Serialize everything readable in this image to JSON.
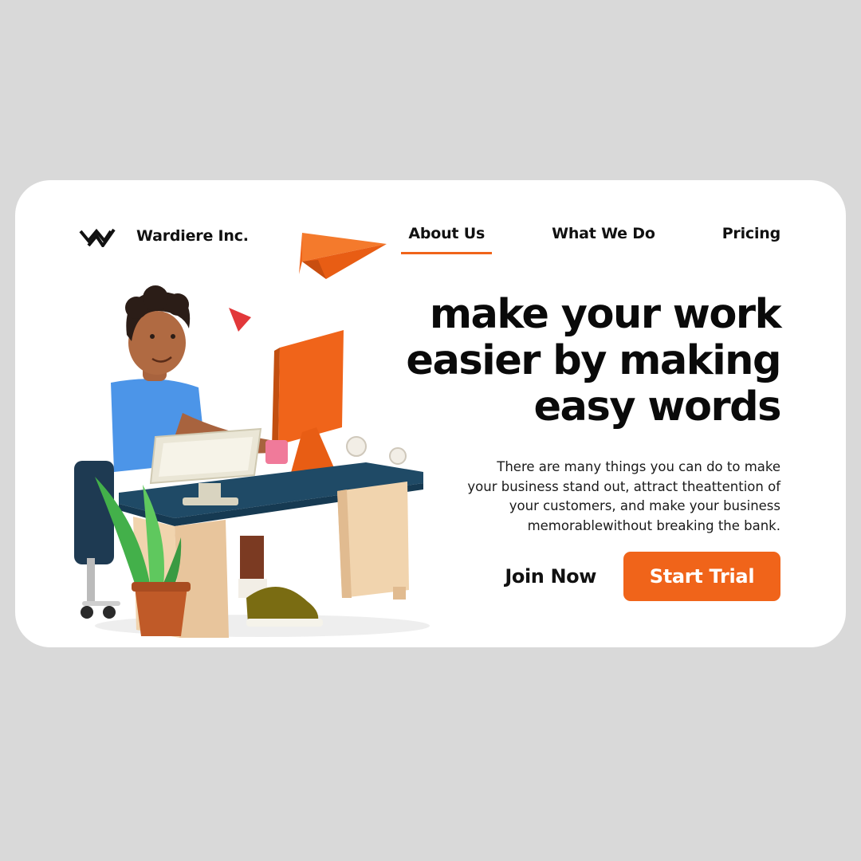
{
  "brand": {
    "name": "Wardiere Inc.",
    "logo_icon": "zigzag-w-logo-icon"
  },
  "nav": {
    "items": [
      {
        "label": "About Us",
        "active": true
      },
      {
        "label": "What We Do",
        "active": false
      },
      {
        "label": "Pricing",
        "active": false
      }
    ]
  },
  "hero": {
    "headline": [
      "make your work",
      "easier by making",
      "easy words"
    ],
    "body_lines": [
      "There are many things you can do to make",
      "your business stand out, attract theattention of",
      "your customers, and make your business",
      "memorablewithout breaking the bank."
    ]
  },
  "cta": {
    "join_label": "Join Now",
    "trial_label": "Start Trial"
  },
  "colors": {
    "accent": "#f0641a",
    "page_bg": "#d9d9d9",
    "card_bg": "#ffffff",
    "text": "#111111"
  }
}
